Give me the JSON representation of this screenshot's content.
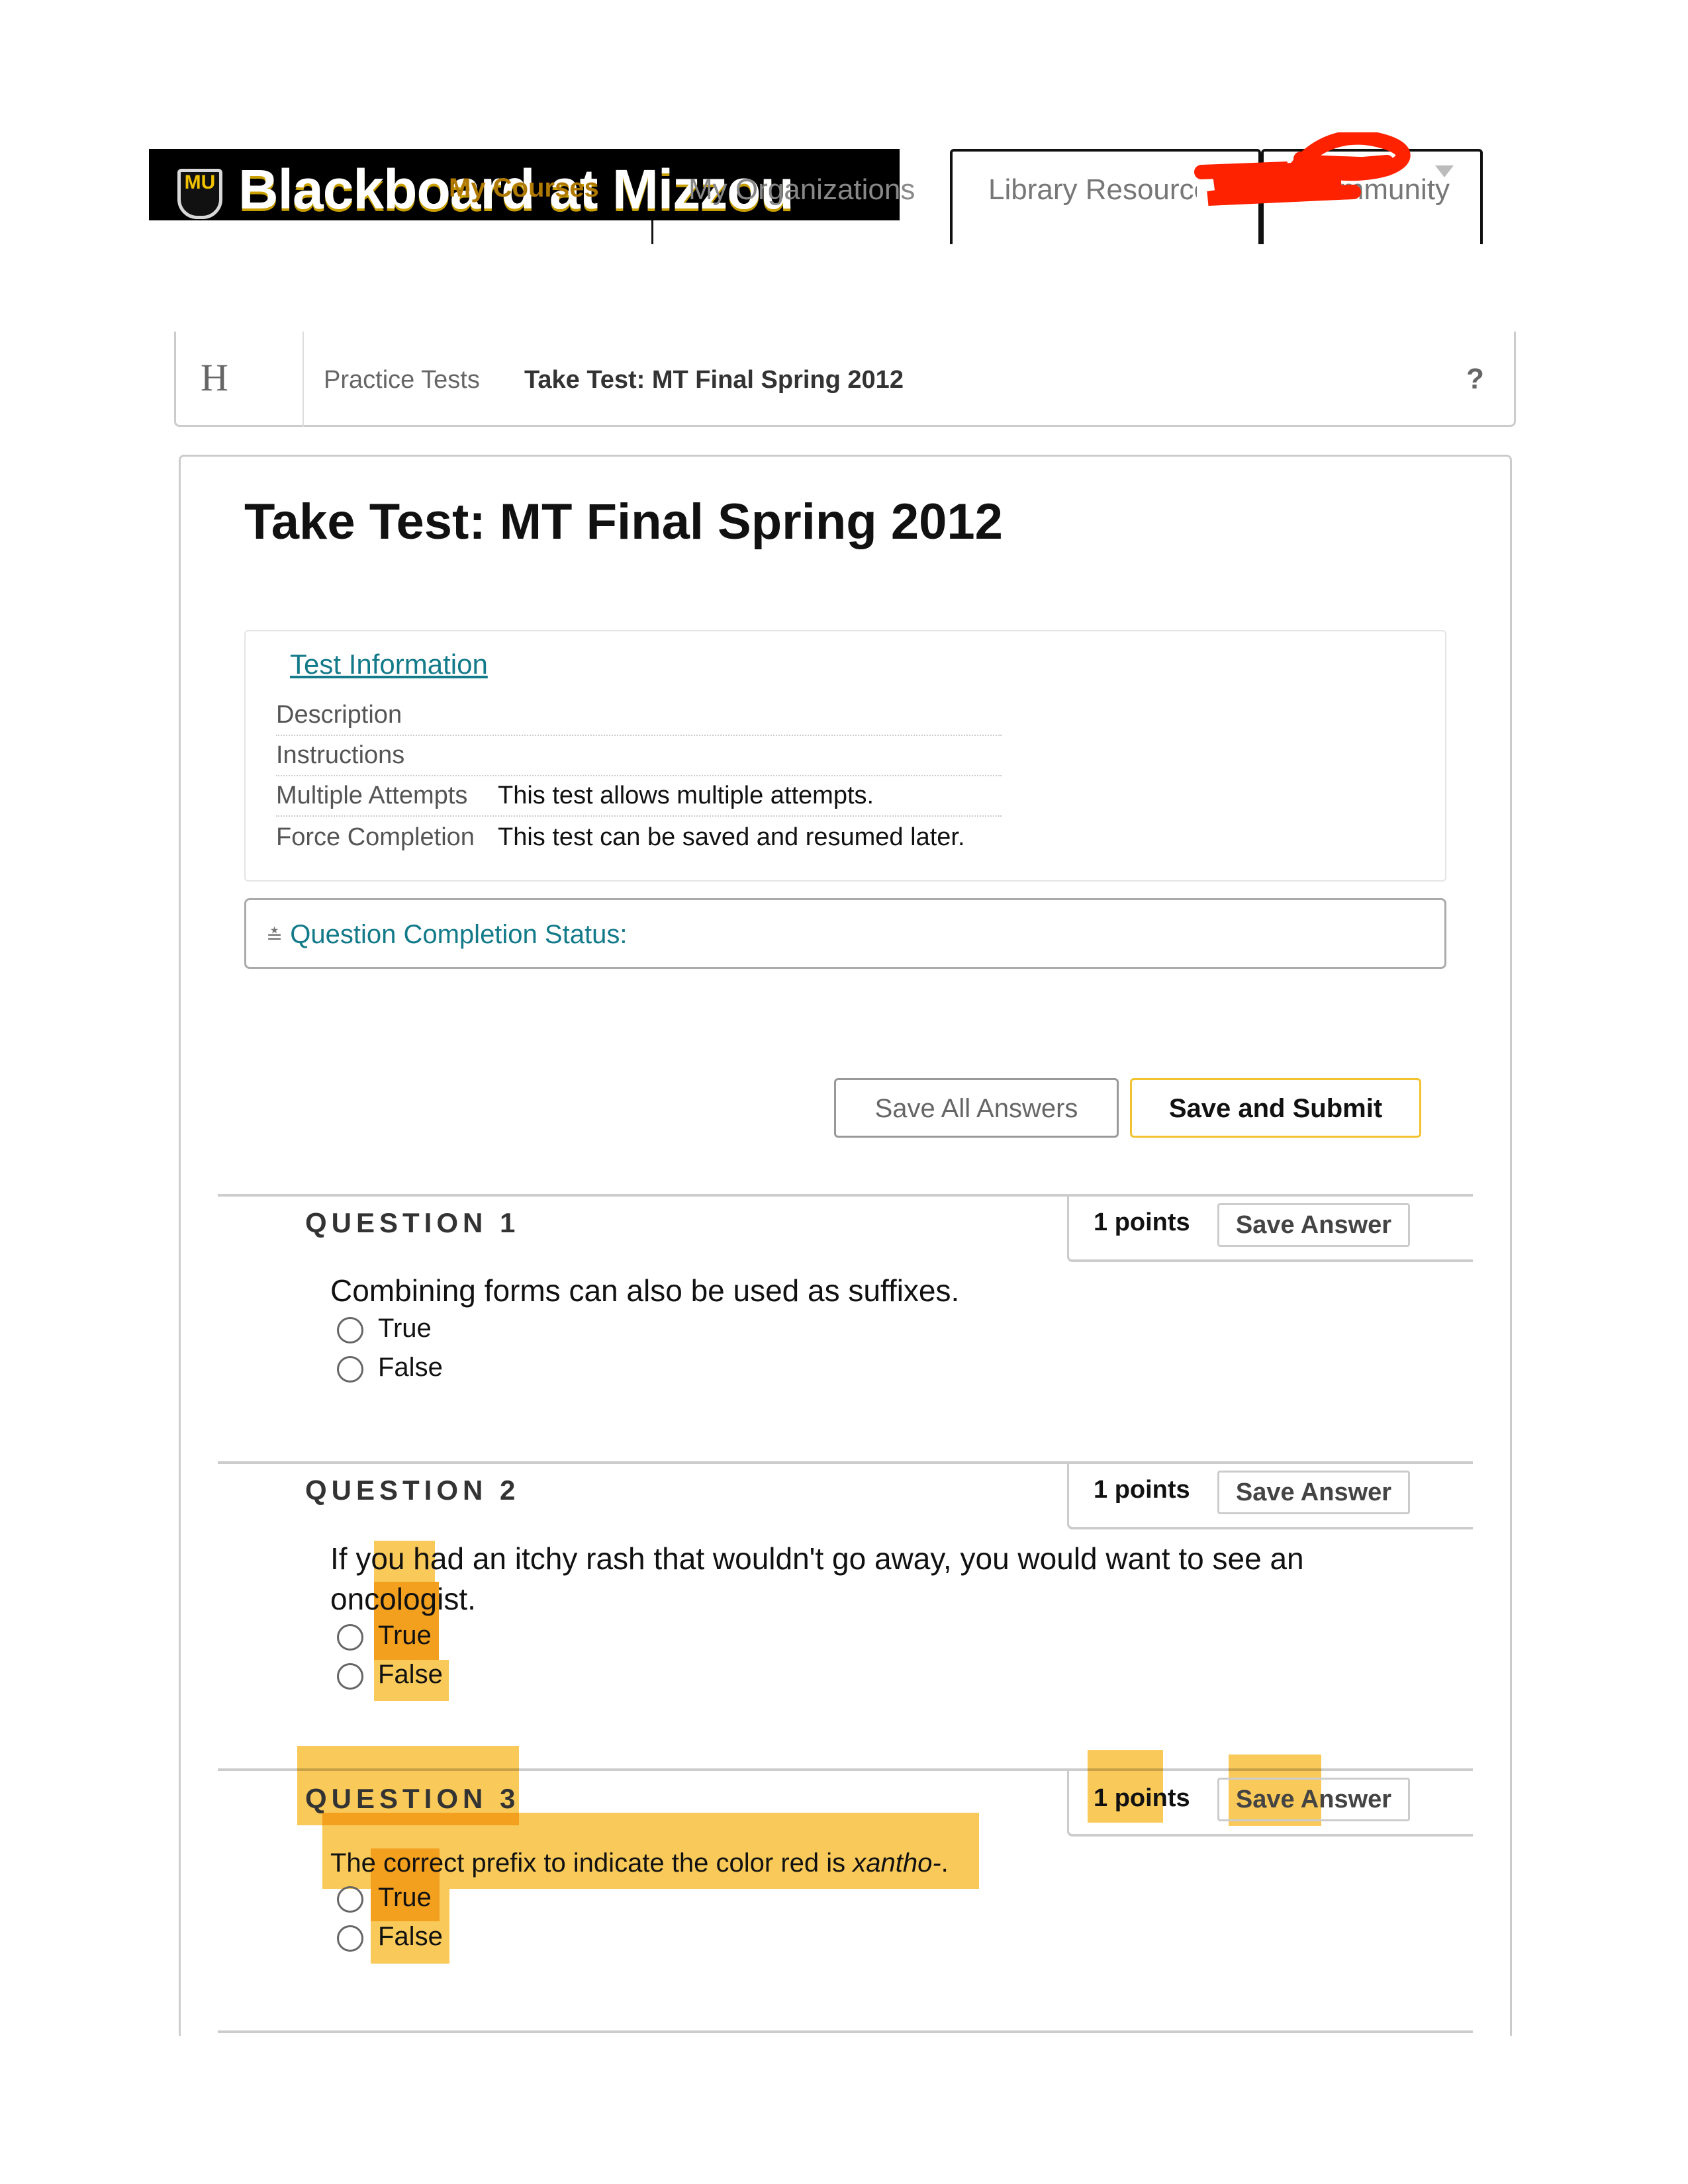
{
  "header": {
    "brand": "Blackboard at Mizzou",
    "logo_text": "MU",
    "nav": [
      "My Courses",
      "My Organizations",
      "Library Resources",
      "Community"
    ]
  },
  "breadcrumb": {
    "home_icon": "H",
    "items": [
      "Practice Tests",
      "Take Test: MT Final Spring 2012"
    ],
    "help": "?"
  },
  "page_title": "Take Test: MT Final Spring 2012",
  "test_info": {
    "link": "Test Information",
    "rows": [
      {
        "label": "Description",
        "value": ""
      },
      {
        "label": "Instructions",
        "value": ""
      },
      {
        "label": "Multiple Attempts",
        "value": "This test allows multiple attempts."
      },
      {
        "label": "Force Completion",
        "value": "This test can be saved and resumed later."
      }
    ]
  },
  "completion_status": {
    "icon": "double-chevron-down-icon",
    "label": "Question Completion Status:"
  },
  "buttons": {
    "save_all": "Save All Answers",
    "save_submit": "Save and Submit"
  },
  "questions": [
    {
      "label": "QUESTION 1",
      "points": "1 points",
      "save": "Save Answer",
      "text": "Combining forms can also be used as suffixes.",
      "options": [
        "True",
        "False"
      ]
    },
    {
      "label": "QUESTION 2",
      "points": "1 points",
      "save": "Save Answer",
      "text": "If you had an itchy rash that wouldn't go away, you would want to see an",
      "text2": "oncologist.",
      "options": [
        "True",
        "False"
      ]
    },
    {
      "label": "QUESTION 3",
      "points": "1 points",
      "save": "Save Answer",
      "text": "The correct prefix to indicate the color red is ",
      "text_italic": "xantho-",
      "text_end": ".",
      "options": [
        "True",
        "False"
      ]
    }
  ],
  "colors": {
    "highlight": "#f9cc5c",
    "highlight_overlap": "#f5a623",
    "link": "#137a8a",
    "scribble": "#ff2200",
    "submit_border": "#f2c230"
  }
}
